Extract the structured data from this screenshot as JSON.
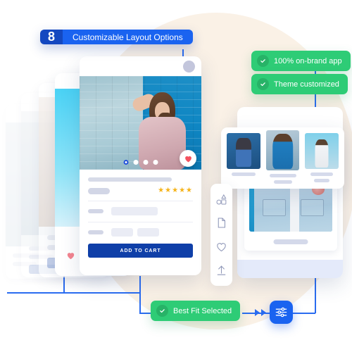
{
  "theme": {
    "brand_blue": "#1a63f0",
    "deep_blue": "#1448c0",
    "navy_button": "#0f3fa8",
    "green": "#2ecc76",
    "beige": "#faf1e6",
    "star_gold": "#f5b319",
    "connector_blue": "#2a6cf0"
  },
  "badges": {
    "numbered": {
      "number": "8",
      "label": "Customizable Layout Options"
    },
    "on_brand": {
      "icon": "check-circle-icon",
      "label": "100% on-brand app"
    },
    "theme": {
      "icon": "check-circle-icon",
      "label": "Theme customized"
    },
    "best_fit": {
      "icon": "check-circle-icon",
      "label": "Best Fit Selected"
    }
  },
  "product_card": {
    "avatar": "avatar-circle",
    "photo_alt": "woman-leaning-on-blue-brick-wall",
    "carousel": {
      "total_dots": 4,
      "active_index": 0
    },
    "favorite_icon": "heart-icon",
    "rating": {
      "stars": "★★★★★",
      "count": 5
    },
    "add_to_cart_label": "ADD TO CART"
  },
  "right_panel": {
    "dropzone": "dashed-upload-area",
    "thumbnails": [
      {
        "alt": "model-in-denim-sitting"
      },
      {
        "alt": "model-in-blue-satin-dress"
      },
      {
        "alt": "model-in-white-dress-sky"
      }
    ],
    "featured": {
      "alt": "denim-jacket-closeup"
    }
  },
  "toolbar": {
    "items": [
      {
        "icon": "shapes-icon"
      },
      {
        "icon": "page-icon"
      },
      {
        "icon": "heart-icon"
      },
      {
        "icon": "upload-icon"
      }
    ]
  },
  "settings_chip": {
    "icon": "sliders-icon"
  },
  "stacked_cards": {
    "count": 4,
    "note": "faded layered product-card previews behind the main card"
  }
}
